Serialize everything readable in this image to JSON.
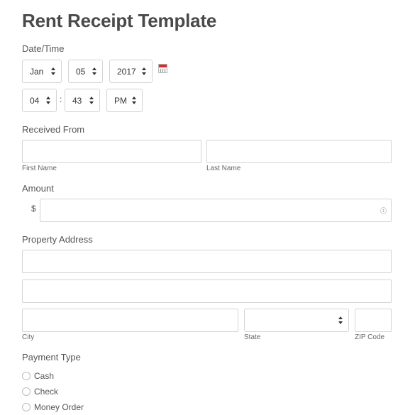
{
  "form": {
    "title": "Rent Receipt Template"
  },
  "datetime": {
    "label": "Date/Time",
    "month": "Jan",
    "day": "05",
    "year": "2017",
    "hour": "04",
    "separator": ":",
    "minute": "43",
    "ampm": "PM",
    "calendar_icon": "calendar-icon"
  },
  "received_from": {
    "label": "Received From",
    "first_name": {
      "value": "",
      "label": "First Name"
    },
    "last_name": {
      "value": "",
      "label": "Last Name"
    }
  },
  "amount": {
    "label": "Amount",
    "currency": "$",
    "value": ""
  },
  "property_address": {
    "label": "Property Address",
    "line1": "",
    "line2": "",
    "city_label": "City",
    "state_label": "State",
    "state_value": "",
    "zip_label": "ZIP Code"
  },
  "payment_type": {
    "label": "Payment Type",
    "options": [
      "Cash",
      "Check",
      "Money Order"
    ]
  }
}
